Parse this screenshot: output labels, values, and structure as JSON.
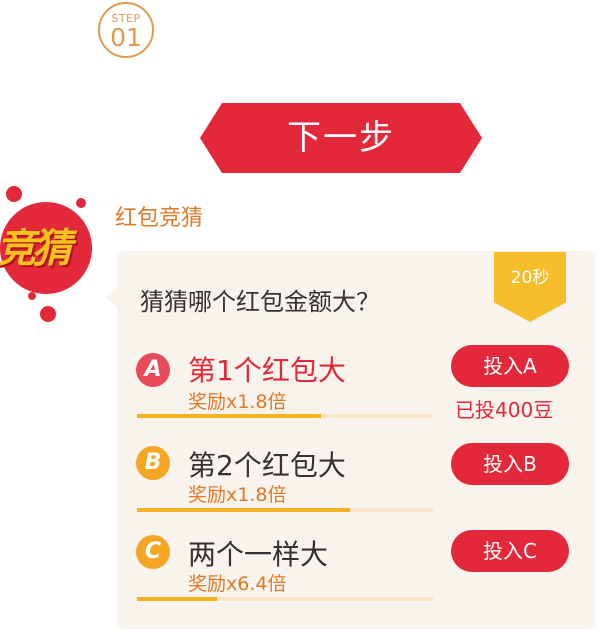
{
  "step": {
    "label": "STEP",
    "number": "01"
  },
  "next_button": "下一步",
  "badge": {
    "text": "竞猜"
  },
  "section_title": "红包竞猜",
  "question": "猜猜哪个红包金额大？",
  "timer": "20秒",
  "options": [
    {
      "letter": "A",
      "title": "第1个红包大",
      "reward": "奖励x1.8倍",
      "progress": 0.62,
      "button": "投入A",
      "invested": "已投400豆"
    },
    {
      "letter": "B",
      "title": "第2个红包大",
      "reward": "奖励x1.8倍",
      "progress": 0.72,
      "button": "投入B"
    },
    {
      "letter": "C",
      "title": "两个一样大",
      "reward": "奖励x6.4倍",
      "progress": 0.27,
      "button": "投入C"
    }
  ],
  "colors": {
    "primary_red": "#e3283a",
    "accent_orange": "#e07a27",
    "gold": "#f5b324"
  }
}
